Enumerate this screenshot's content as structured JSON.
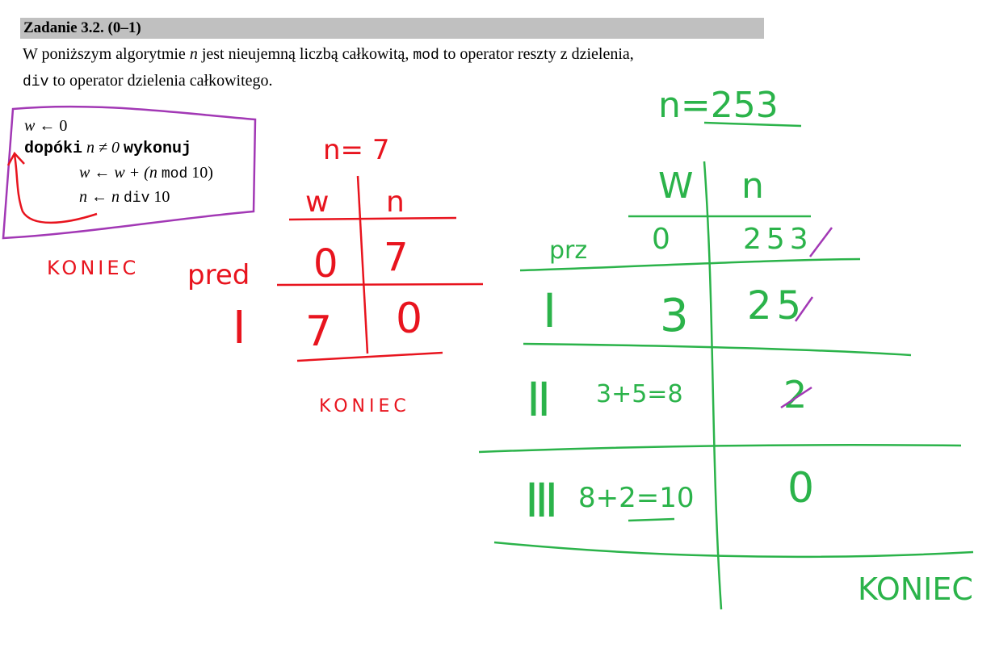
{
  "task": {
    "title": "Zadanie 3.2. (0–1)",
    "desc_1": "W poniższym algorytmie ",
    "desc_n": "n",
    "desc_2": " jest nieujemną liczbą całkowitą, ",
    "desc_mod": "mod",
    "desc_3": " to operator reszty z dzielenia,",
    "desc_div": "div",
    "desc_4": " to operator dzielenia całkowitego."
  },
  "algorithm": {
    "l1_var": "w",
    "l1_rest": " ← 0",
    "l2_kw1": "dopóki",
    "l2_cond": " n ≠ 0 ",
    "l2_kw2": "wykonuj",
    "l3_a": "w ← w + (n ",
    "l3_mod": "mod",
    "l3_b": " 10)",
    "l4_a": "n ← n ",
    "l4_div": "div",
    "l4_b": " 10"
  },
  "red_notes": {
    "n_label": "n= 7",
    "col_w": "w",
    "col_n": "n",
    "row_before": "pred",
    "row_before_w": "0",
    "row_before_n": "7",
    "row_1": "I",
    "row_1_w": "7",
    "row_1_n": "0",
    "end_left": "KONIEC",
    "end_bottom": "KONIEC"
  },
  "green_notes": {
    "n_label": "n=253",
    "col_w": "W",
    "col_n": "n",
    "row_before": "prz",
    "row_before_w": "0",
    "row_before_n": "253",
    "row_1": "I",
    "row_1_w": "3",
    "row_1_n": "25",
    "row_2": "II",
    "row_2_w": "3+5=8",
    "row_2_n": "2",
    "row_3": "III",
    "row_3_w": "8+2=10",
    "row_3_n": "0",
    "end": "KONIEC"
  },
  "colors": {
    "red": "#e8141e",
    "green": "#2bb34a",
    "purple": "#a238b5",
    "header_bg": "#c0c0c0"
  }
}
